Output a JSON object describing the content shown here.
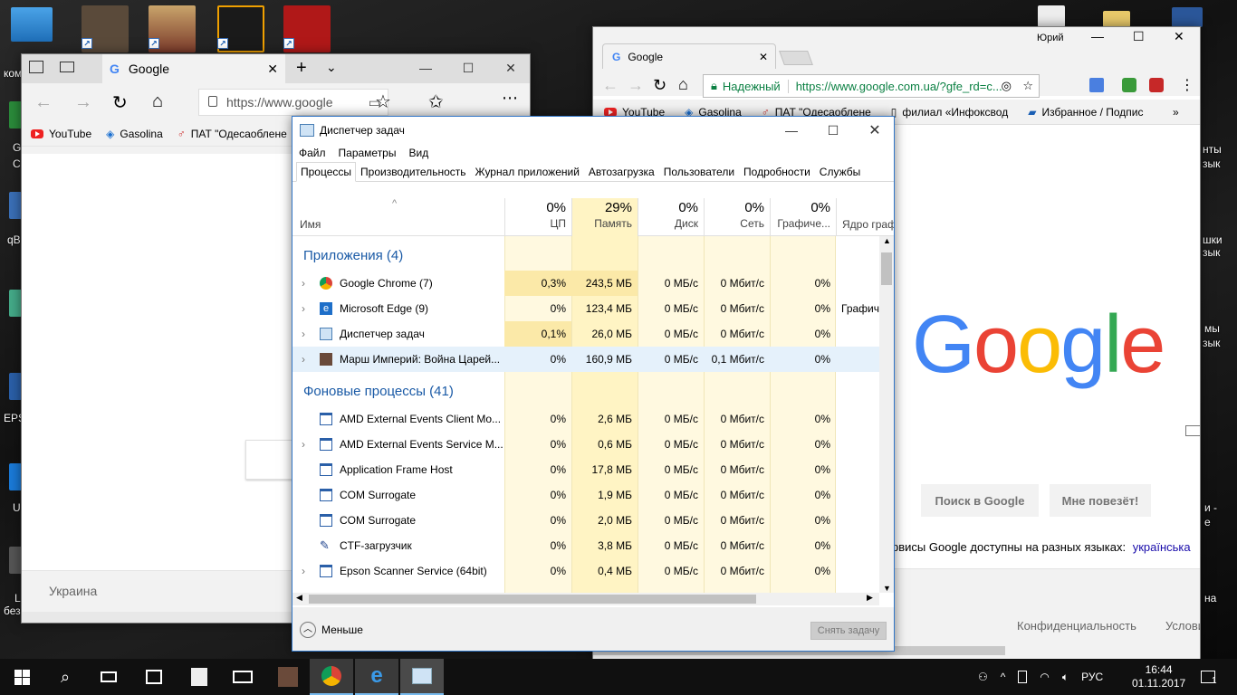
{
  "desktop": {
    "labels": [
      "ком",
      "G",
      "C",
      "qB",
      "EPS",
      "U",
      "L",
      "безо",
      "нты",
      "зык",
      "шки",
      "зык",
      "мы",
      "зык",
      "и -",
      "е",
      "на"
    ]
  },
  "edge": {
    "tab_title": "Google",
    "address": "https://www.google",
    "favorites": [
      "YouTube",
      "Gasolina",
      "ПАТ \"Одесаоблене"
    ],
    "footer_text": "Украина"
  },
  "chrome": {
    "user": "Юрий",
    "tab_title": "Google",
    "secure_label": "Надежный",
    "address": "https://www.google.com.ua/?gfe_rd=c...",
    "bookmarks": [
      "YouTube",
      "Gasolina",
      "ПАТ \"Одесаоблене",
      "филиал «Инфоксвод",
      "Избранное / Подпис"
    ],
    "logo": "Google",
    "search_button": "Поиск в Google",
    "lucky_button": "Мне повезёт!",
    "languages_text": "рвисы Google доступны на разных языках:",
    "language_link": "українська",
    "privacy": "Конфиденциальность",
    "terms": "Услови"
  },
  "taskmgr": {
    "title": "Диспетчер задач",
    "menu": [
      "Файл",
      "Параметры",
      "Вид"
    ],
    "tabs": [
      "Процессы",
      "Производительность",
      "Журнал приложений",
      "Автозагрузка",
      "Пользователи",
      "Подробности",
      "Службы"
    ],
    "columns": {
      "name": "Имя",
      "cpu_pct": "0%",
      "cpu": "ЦП",
      "mem_pct": "29%",
      "mem": "Память",
      "disk_pct": "0%",
      "disk": "Диск",
      "net_pct": "0%",
      "net": "Сеть",
      "gpu_pct": "0%",
      "gpu": "Графиче...",
      "gpu_engine": "Ядро граф"
    },
    "apps_header": "Приложения (4)",
    "apps": [
      {
        "name": "Google Chrome (7)",
        "cpu": "0,3%",
        "mem": "243,5 МБ",
        "disk": "0 МБ/с",
        "net": "0 Мбит/с",
        "gpu": "0%",
        "engine": ""
      },
      {
        "name": "Microsoft Edge (9)",
        "cpu": "0%",
        "mem": "123,4 МБ",
        "disk": "0 МБ/с",
        "net": "0 Мбит/с",
        "gpu": "0%",
        "engine": "Графич"
      },
      {
        "name": "Диспетчер задач",
        "cpu": "0,1%",
        "mem": "26,0 МБ",
        "disk": "0 МБ/с",
        "net": "0 Мбит/с",
        "gpu": "0%",
        "engine": ""
      },
      {
        "name": "Марш Империй: Война Царей...",
        "cpu": "0%",
        "mem": "160,9 МБ",
        "disk": "0 МБ/с",
        "net": "0,1 Мбит/с",
        "gpu": "0%",
        "engine": ""
      }
    ],
    "bg_header": "Фоновые процессы (41)",
    "bg": [
      {
        "name": "AMD External Events Client Mo...",
        "cpu": "0%",
        "mem": "2,6 МБ",
        "disk": "0 МБ/с",
        "net": "0 Мбит/с",
        "gpu": "0%"
      },
      {
        "name": "AMD External Events Service M...",
        "cpu": "0%",
        "mem": "0,6 МБ",
        "disk": "0 МБ/с",
        "net": "0 Мбит/с",
        "gpu": "0%"
      },
      {
        "name": "Application Frame Host",
        "cpu": "0%",
        "mem": "17,8 МБ",
        "disk": "0 МБ/с",
        "net": "0 Мбит/с",
        "gpu": "0%"
      },
      {
        "name": "COM Surrogate",
        "cpu": "0%",
        "mem": "1,9 МБ",
        "disk": "0 МБ/с",
        "net": "0 Мбит/с",
        "gpu": "0%"
      },
      {
        "name": "COM Surrogate",
        "cpu": "0%",
        "mem": "2,0 МБ",
        "disk": "0 МБ/с",
        "net": "0 Мбит/с",
        "gpu": "0%"
      },
      {
        "name": "CTF-загрузчик",
        "cpu": "0%",
        "mem": "3,8 МБ",
        "disk": "0 МБ/с",
        "net": "0 Мбит/с",
        "gpu": "0%"
      },
      {
        "name": "Epson Scanner Service (64bit)",
        "cpu": "0%",
        "mem": "0,4 МБ",
        "disk": "0 МБ/с",
        "net": "0 Мбит/с",
        "gpu": "0%"
      }
    ],
    "less_label": "Меньше",
    "end_task": "Снять задачу"
  },
  "taskbar": {
    "lang": "РУС",
    "time": "16:44",
    "date": "01.11.2017",
    "notifications": "1"
  }
}
